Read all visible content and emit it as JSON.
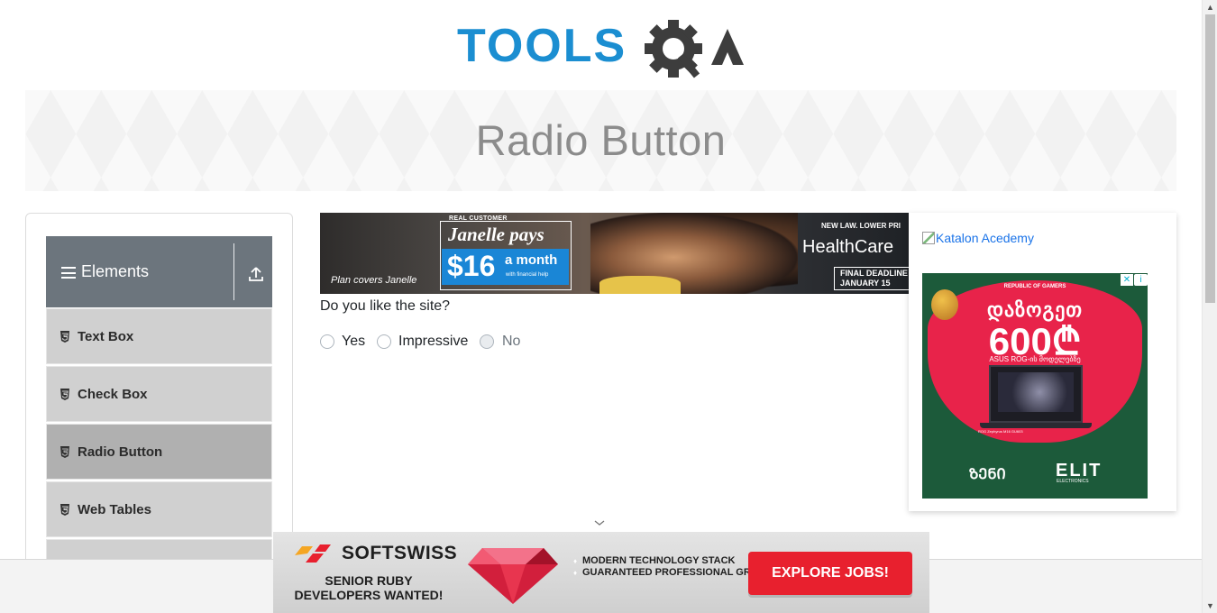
{
  "header": {
    "logo_alt": "TOOLSQA",
    "page_title": "Radio Button"
  },
  "sidebar": {
    "group_label": "Elements",
    "items": [
      {
        "label": "Text Box"
      },
      {
        "label": "Check Box"
      },
      {
        "label": "Radio Button",
        "active": true
      },
      {
        "label": "Web Tables"
      }
    ]
  },
  "main": {
    "question": "Do you like the site?",
    "options": [
      {
        "label": "Yes",
        "checked": false,
        "disabled": false
      },
      {
        "label": "Impressive",
        "checked": false,
        "disabled": false
      },
      {
        "label": "No",
        "checked": false,
        "disabled": true
      }
    ]
  },
  "top_ad": {
    "caption": "Plan covers Janelle",
    "eyebrow": "REAL CUSTOMER",
    "name": "Janelle pays",
    "price": "$16",
    "per": "a month",
    "help": "with financial help",
    "newlaw": "NEW LAW. LOWER PRI",
    "brand": "HealthCare",
    "deadline_line1": "FINAL DEADLINE",
    "deadline_line2": "JANUARY 15"
  },
  "right_ad": {
    "broken_image_alt": "Katalon Acedemy",
    "rog_logo": "REPUBLIC OF GAMERS",
    "headline": "დაზოგეთ",
    "amount": "600₾",
    "sub": "ASUS ROG-ის მოდელებზე",
    "small_print": "ROG Zephyrus M16 GU603",
    "brand1": "ᲖᲔᲜᲘ",
    "brand2": "ELIT",
    "brand_sub": "ELECTRONICS",
    "ad_choices_icon": "i",
    "close_icon": "✕"
  },
  "bottom_ad": {
    "brand": "SOFTSWISS",
    "tagline": "SENIOR RUBY DEVELOPERS WANTED!",
    "points": [
      "MODERN TECHNOLOGY STACK",
      "GUARANTEED PROFESSIONAL GROWTH"
    ],
    "cta": "EXPLORE JOBS!"
  },
  "colors": {
    "logo_blue": "#1b8ed1",
    "logo_dark": "#3d3d3d",
    "sidebar_header": "#6c757d",
    "menu_item": "#d0d0d0",
    "menu_item_active": "#b0b0b0",
    "cta_red": "#e8202e"
  }
}
